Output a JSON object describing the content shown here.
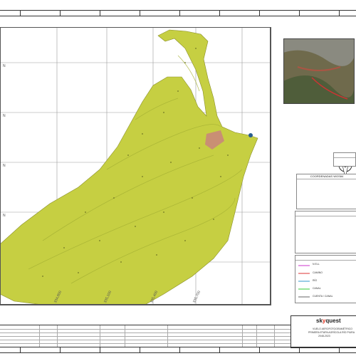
{
  "map": {
    "x_coordinates": [
      "334,800",
      "335,100",
      "335,400",
      "335,700"
    ],
    "y_label": "N"
  },
  "right_panel": {
    "logo_prefix": "sk",
    "logo_accent": "y",
    "logo_suffix": "quest",
    "title_line1": "VUELO AEROFOTOGRAMÉTRICO",
    "title_line2": "PRIMERA ETAPA AGRÍCOLA RÍO PIURA",
    "title_line3": "2048-2023",
    "legend_items": [
      "N ELL",
      "CAMINO",
      "RÍO",
      "CANAL",
      "CUENTA / CANAL"
    ],
    "coord_header": "COORDENADAS WGS84"
  },
  "colors": {
    "terrain": "#c6cf42",
    "terrain_dark": "#a6b234",
    "accent": "#e6321e"
  }
}
